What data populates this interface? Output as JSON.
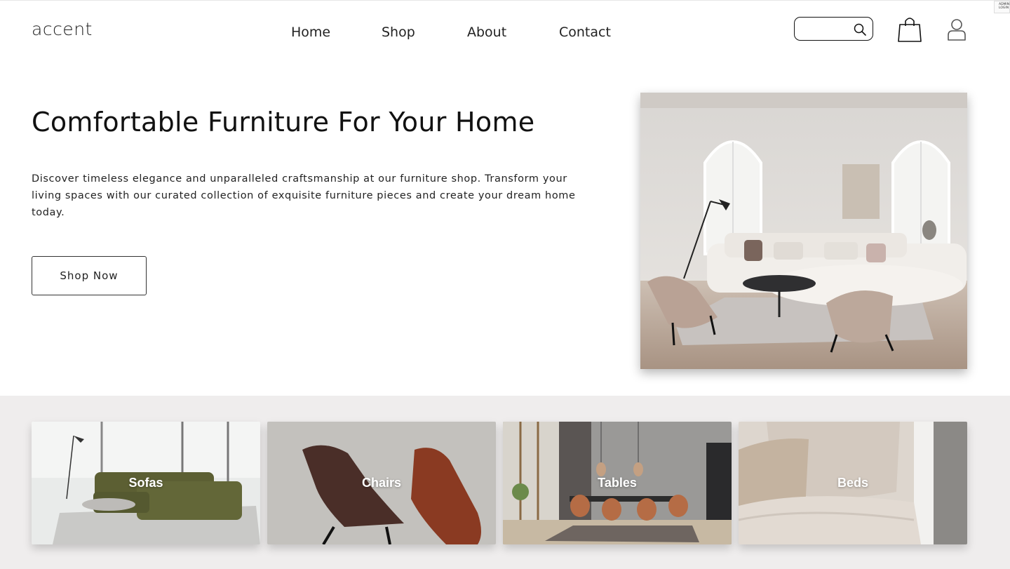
{
  "header": {
    "logo": "accent",
    "nav": [
      "Home",
      "Shop",
      "About",
      "Contact"
    ],
    "search_placeholder": "",
    "admin_badge": "ADMIN LOGIN"
  },
  "hero": {
    "title": "Comfortable Furniture For Your Home",
    "description": "Discover timeless elegance and unparalleled craftsmanship at our furniture shop. Transform your living spaces with our curated collection of exquisite furniture pieces and create your dream home today.",
    "cta": "Shop Now"
  },
  "categories": [
    {
      "label": "Sofas"
    },
    {
      "label": "Chairs"
    },
    {
      "label": "Tables"
    },
    {
      "label": "Beds"
    }
  ],
  "icons": {
    "search": "search-icon",
    "cart": "shopping-bag-icon",
    "account": "user-icon"
  },
  "colors": {
    "background": "#ffffff",
    "category_band": "#efeded",
    "text": "#111111"
  }
}
